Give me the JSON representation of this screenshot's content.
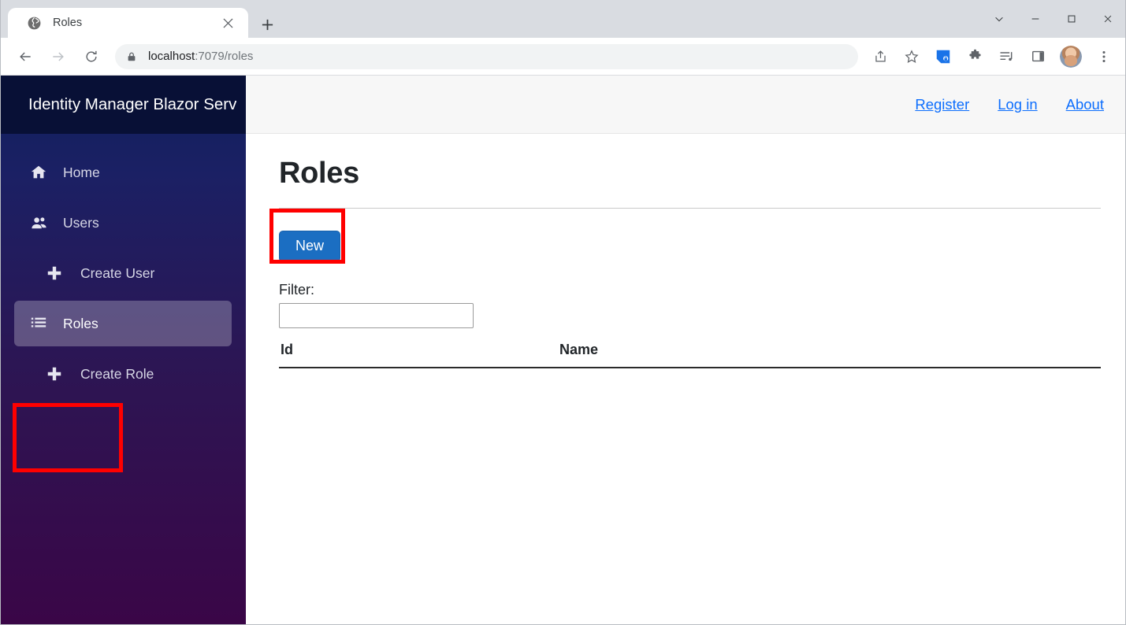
{
  "browser": {
    "tab": {
      "title": "Roles",
      "favicon_icon": "globe-icon",
      "close_icon": "close-icon"
    },
    "new_tab_icon": "plus-icon",
    "window_controls": {
      "tab_search_icon": "chevron-down-icon",
      "minimize_icon": "minimize-icon",
      "maximize_icon": "maximize-icon",
      "close_icon": "close-icon"
    },
    "toolbar": {
      "back_icon": "back-arrow-icon",
      "forward_icon": "forward-arrow-icon",
      "reload_icon": "reload-icon",
      "site_security_icon": "lock-icon",
      "url_host": "localhost",
      "url_path": ":7079/roles",
      "share_icon": "share-icon",
      "bookmark_icon": "star-icon",
      "extension_secure_icon": "secure-extension-icon",
      "extensions_icon": "puzzle-piece-icon",
      "playlist_icon": "playlist-icon",
      "side_panel_icon": "side-panel-icon",
      "profile_icon": "avatar",
      "menu_icon": "three-dot-menu-icon"
    }
  },
  "app": {
    "brand_title": "Identity Manager Blazor Serv",
    "topbar_links": [
      {
        "label": "Register"
      },
      {
        "label": "Log in"
      },
      {
        "label": "About"
      }
    ],
    "sidebar": {
      "items": [
        {
          "label": "Home",
          "icon": "home-icon",
          "active": false,
          "indent": false
        },
        {
          "label": "Users",
          "icon": "users-icon",
          "active": false,
          "indent": false
        },
        {
          "label": "Create User",
          "icon": "plus-icon",
          "active": false,
          "indent": true
        },
        {
          "label": "Roles",
          "icon": "list-icon",
          "active": true,
          "indent": false
        },
        {
          "label": "Create Role",
          "icon": "plus-icon",
          "active": false,
          "indent": true
        }
      ]
    },
    "main": {
      "page_title": "Roles",
      "new_button_label": "New",
      "filter_label": "Filter:",
      "filter_value": "",
      "filter_placeholder": "",
      "table": {
        "columns": [
          "Id",
          "Name"
        ],
        "rows": []
      }
    }
  },
  "colors": {
    "accent_blue": "#1b6ec2",
    "link_blue": "#0d6efd",
    "annotation_red": "#ff0000",
    "sidebar_top": "#0f1f5c",
    "sidebar_bottom": "#3a0647",
    "brand_bar": "#081036"
  }
}
